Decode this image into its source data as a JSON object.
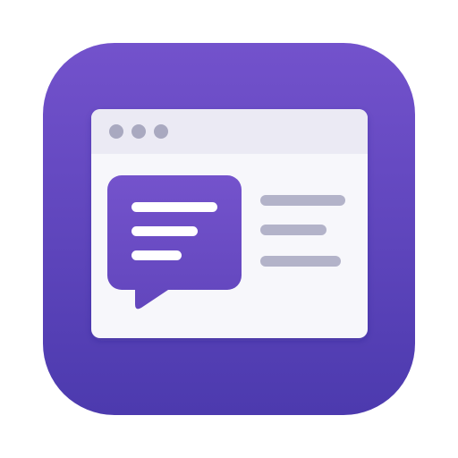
{
  "app_icon": {
    "icon": "chat-window-app-icon",
    "colors": {
      "tile_top": "#7352CC",
      "tile_bottom": "#4C3AAE",
      "window_body": "#F7F7FB",
      "window_titlebar": "#EBEAF4",
      "window_dots": "#A9A9C0",
      "bubble_top": "#7453CC",
      "bubble_bottom": "#6246BD",
      "bubble_lines": "#FFFFFF",
      "text_placeholder_lines": "#B3B3C9"
    },
    "window_controls": [
      "dot",
      "dot",
      "dot"
    ],
    "bubble_text_lines": 3,
    "placeholder_text_lines": 3
  }
}
